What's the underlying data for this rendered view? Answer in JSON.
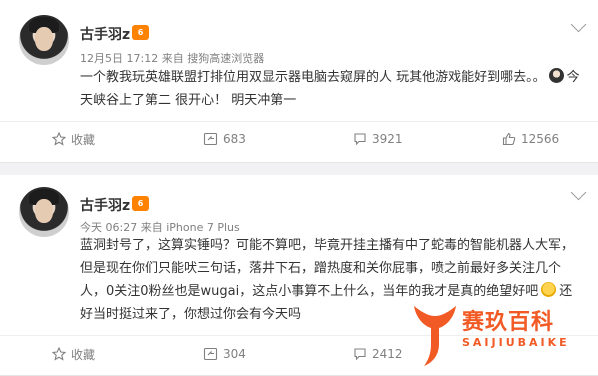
{
  "posts": [
    {
      "username": "古手羽z",
      "vip_badge": "6",
      "time": "12月5日 17:12",
      "source_prefix": "来自",
      "source": "搜狗高速浏览器",
      "text_a": "一个教我玩英雄联盟打排位用双显示器电脑去窥屏的人 玩其他游戏能好到哪去。。",
      "text_b": "今天峡谷上了第二 很开心！ 明天冲第一",
      "actions": {
        "favorite": "收藏",
        "repost": "683",
        "comment": "3921",
        "like": "12566"
      }
    },
    {
      "username": "古手羽z",
      "vip_badge": "6",
      "time": "今天 06:27",
      "source_prefix": "来自",
      "source": "iPhone 7 Plus",
      "text_a": "蓝洞封号了，这算实锤吗？可能不算吧，毕竟开挂主播有中了蛇毒的智能机器人大军，但是现在你们只能吠三句话，落井下石，蹭热度和关你屁事，喷之前最好多关注几个人，0关注0粉丝也是wugai，这点小事算不上什么，当年的我才是真的绝望好吧",
      "text_b": "还好当时挺过来了，你想过你会有今天吗",
      "actions": {
        "favorite": "收藏",
        "repost": "304",
        "comment": "2412",
        "like": ""
      }
    }
  ],
  "watermark": {
    "name": "赛玖百科",
    "sub": "SAIJIUBAIKE"
  },
  "colors": {
    "accent": "#ff8200",
    "watermark": "#f15a24"
  }
}
